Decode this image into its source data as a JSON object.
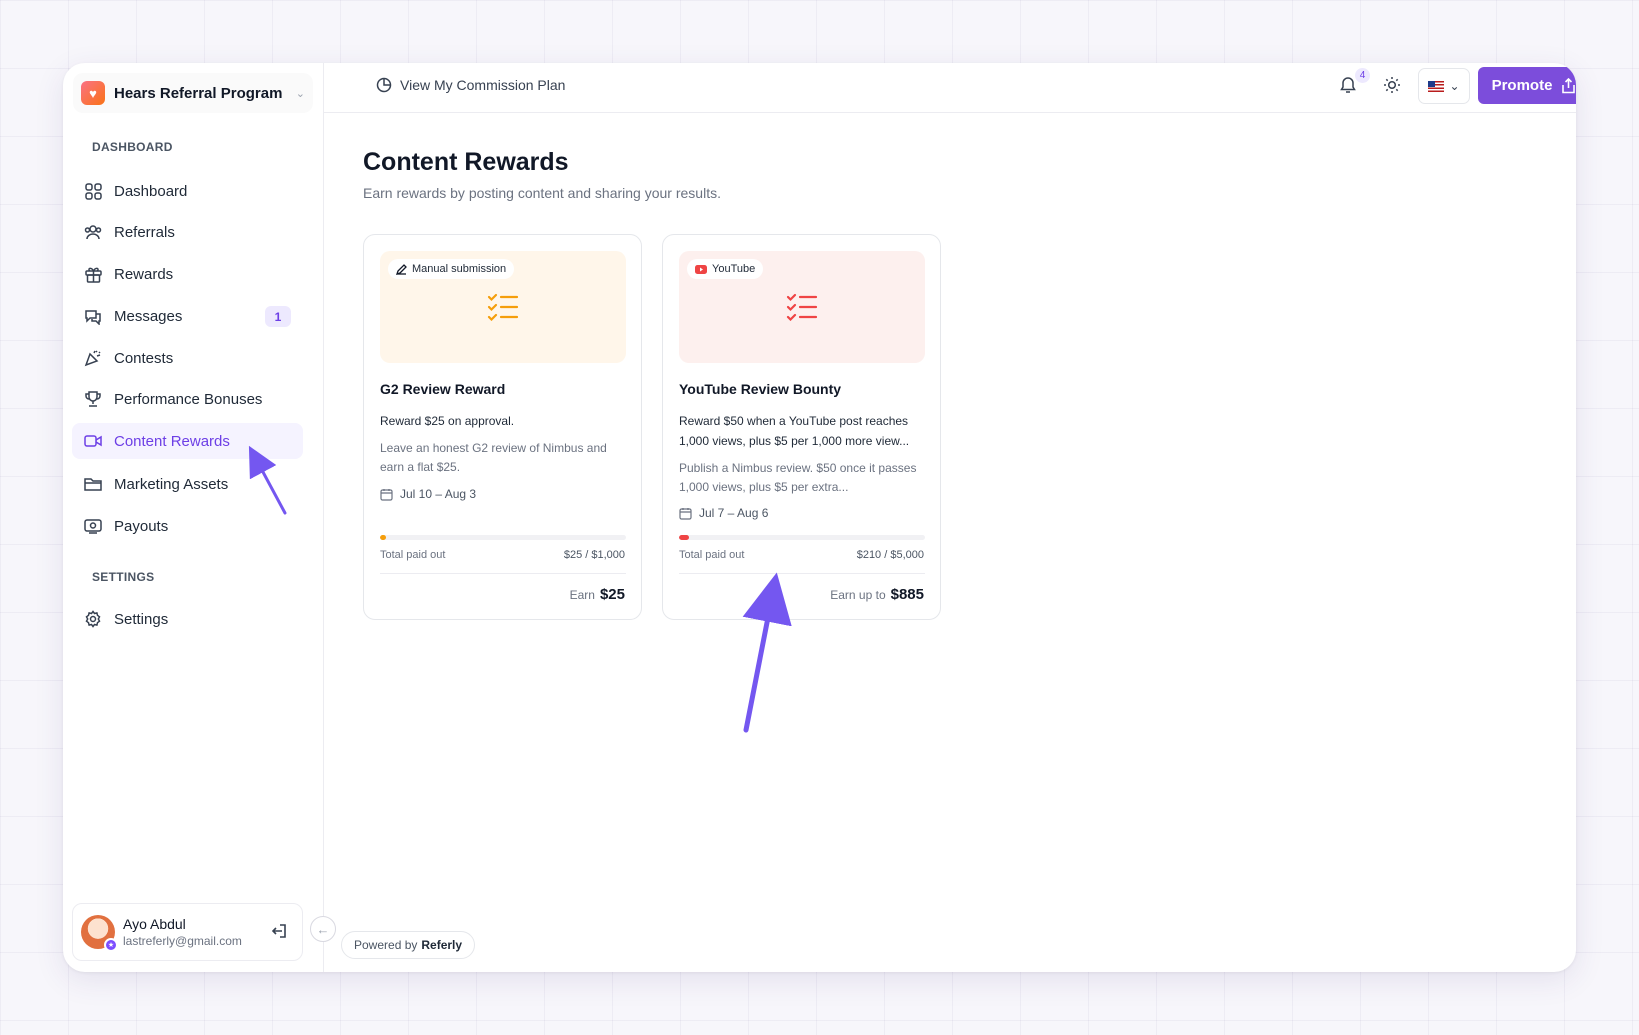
{
  "program": {
    "name": "Hears Referral Program"
  },
  "sidebar": {
    "section_dashboard": "DASHBOARD",
    "section_settings": "SETTINGS",
    "items": [
      {
        "label": "Dashboard",
        "icon": "grid-icon"
      },
      {
        "label": "Referrals",
        "icon": "users-icon"
      },
      {
        "label": "Rewards",
        "icon": "gift-icon"
      },
      {
        "label": "Messages",
        "icon": "chat-icon",
        "badge": "1"
      },
      {
        "label": "Contests",
        "icon": "party-icon"
      },
      {
        "label": "Performance Bonuses",
        "icon": "trophy-icon"
      },
      {
        "label": "Content Rewards",
        "icon": "video-icon",
        "active": true
      },
      {
        "label": "Marketing Assets",
        "icon": "folder-icon"
      },
      {
        "label": "Payouts",
        "icon": "wallet-icon"
      }
    ],
    "settings": {
      "label": "Settings",
      "icon": "gear-icon"
    }
  },
  "user": {
    "name": "Ayo Abdul",
    "email": "lastreferly@gmail.com"
  },
  "topbar": {
    "commission_link": "View My Commission Plan",
    "notification_count": "4",
    "promote_label": "Promote"
  },
  "page": {
    "title": "Content Rewards",
    "subtitle": "Earn rewards by posting content and sharing your results."
  },
  "cards": [
    {
      "tag": "Manual submission",
      "title": "G2 Review Reward",
      "reward": "Reward $25 on approval.",
      "description": "Leave an honest G2 review of Nimbus and earn a flat $25.",
      "dates": "Jul 10 – Aug 3",
      "paid_label": "Total paid out",
      "paid_value": "$25 / $1,000",
      "progress": 0.025,
      "earn_prefix": "Earn",
      "earn_amount": "$25",
      "accent": "#f59e0b"
    },
    {
      "tag": "YouTube",
      "title": "YouTube Review Bounty",
      "reward": "Reward $50 when a YouTube post reaches 1,000 views, plus $5 per 1,000 more view...",
      "description": "Publish a Nimbus review. $50 once it passes 1,000 views, plus $5 per extra...",
      "dates": "Jul 7 – Aug 6",
      "paid_label": "Total paid out",
      "paid_value": "$210 / $5,000",
      "progress": 0.042,
      "earn_prefix": "Earn up to",
      "earn_amount": "$885",
      "accent": "#ef4444"
    }
  ],
  "footer": {
    "powered_prefix": "Powered by",
    "powered_brand": "Referly"
  },
  "colors": {
    "brand": "#7c4ddb",
    "annotation_arrow": "#7457f0"
  }
}
